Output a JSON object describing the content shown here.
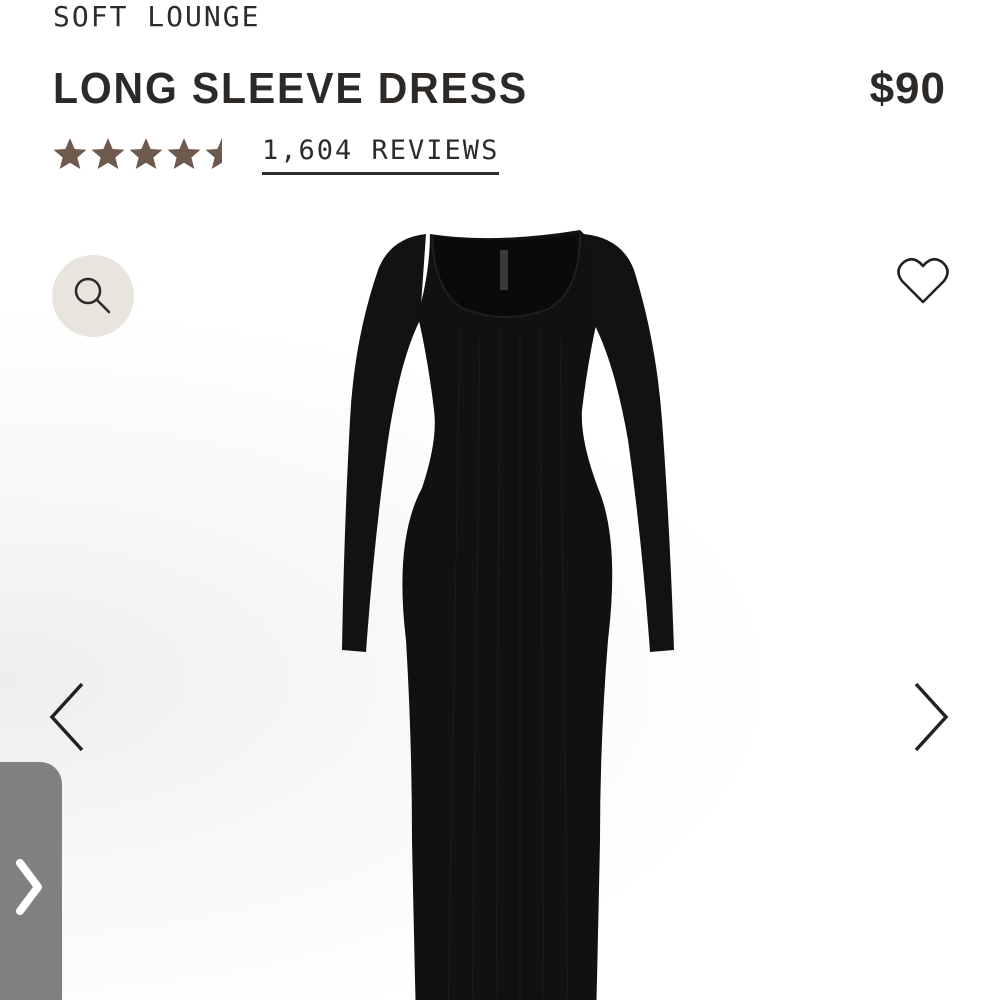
{
  "product": {
    "collection": "SOFT LOUNGE",
    "title": "LONG SLEEVE DRESS",
    "price": "$90",
    "rating": 4.5,
    "rating_max": 5,
    "reviews_label": "1,604 REVIEWS"
  },
  "colors": {
    "star": "#6e5a4c",
    "text": "#2d2926",
    "zoom_bg": "#e9e4de",
    "side_tab": "#808080"
  },
  "icons": {
    "zoom": "search-icon",
    "favorite": "heart-icon",
    "prev": "chevron-left-icon",
    "next": "chevron-right-icon",
    "side_tab": "chevron-right-icon"
  }
}
